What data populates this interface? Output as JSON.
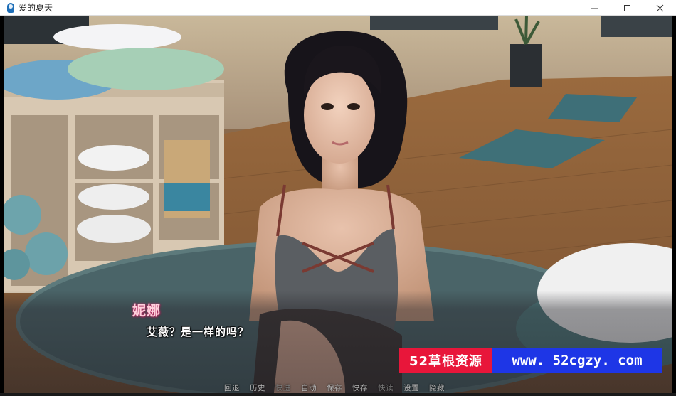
{
  "window": {
    "title": "爱的夏天",
    "minimize_icon": "minimize-icon",
    "maximize_icon": "maximize-icon",
    "close_icon": "close-icon"
  },
  "scene": {
    "description_icon": "game-scene-image",
    "watermark_text": "www. 52cgzy. com"
  },
  "dialogue": {
    "speaker": "妮娜",
    "text": "艾薇？是一样的吗？",
    "speaker_color": "#ffd0dc"
  },
  "quick_menu": {
    "items": [
      "回退",
      "历史",
      "快进",
      "自动",
      "保存",
      "快存",
      "快读",
      "设置",
      "隐藏"
    ]
  },
  "banner": {
    "left_text": "52草根资源",
    "right_text": "www. 52cgzy. com",
    "left_color": "#e8163a",
    "right_color": "#1e36e6"
  }
}
